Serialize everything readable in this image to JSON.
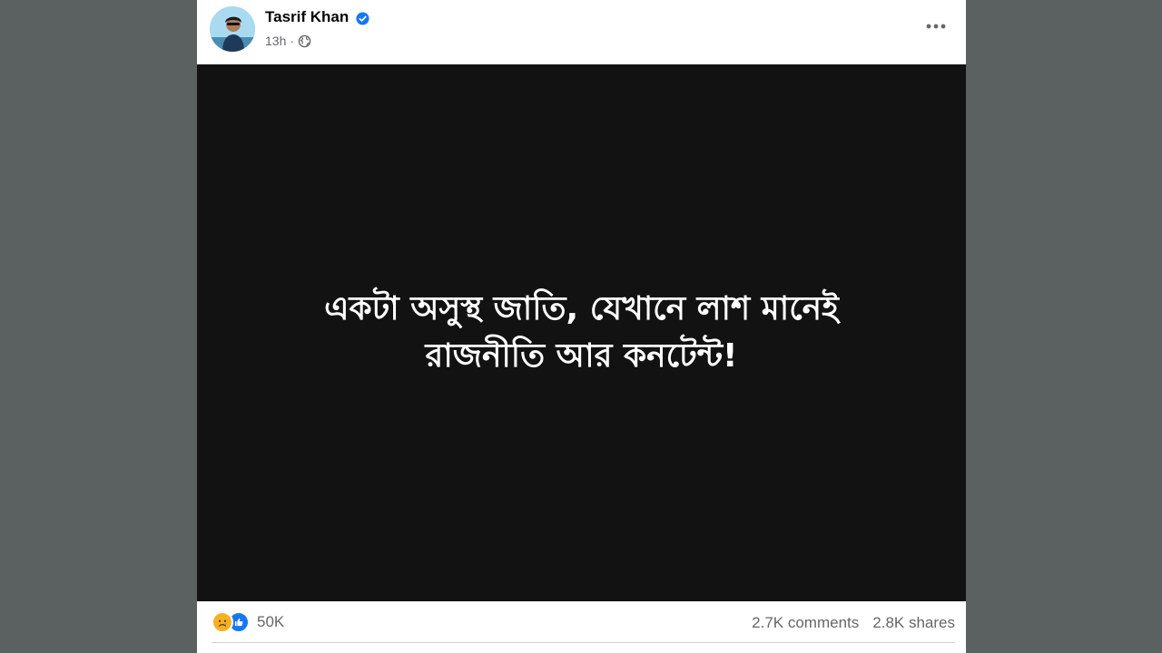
{
  "post": {
    "author": "Tasrif Khan",
    "time": "13h",
    "separator": "·",
    "text_line1": "একটা অসুস্থ জাতি, যেখানে লাশ মানেই",
    "text_line2": "রাজনীতি আর কনটেন্ট!"
  },
  "icons": {
    "verified": "verified-badge-icon",
    "privacy": "globe-icon",
    "more": "more-horizontal-icon",
    "reactions": [
      "sad-reaction-icon",
      "like-reaction-icon"
    ]
  },
  "footer": {
    "reaction_count": "50K",
    "comments": "2.7K comments",
    "shares": "2.8K shares"
  },
  "colors": {
    "page_background": "#5b6060",
    "media_background": "#121212",
    "verified_blue": "#1877f2",
    "secondary_text": "#65676b"
  }
}
